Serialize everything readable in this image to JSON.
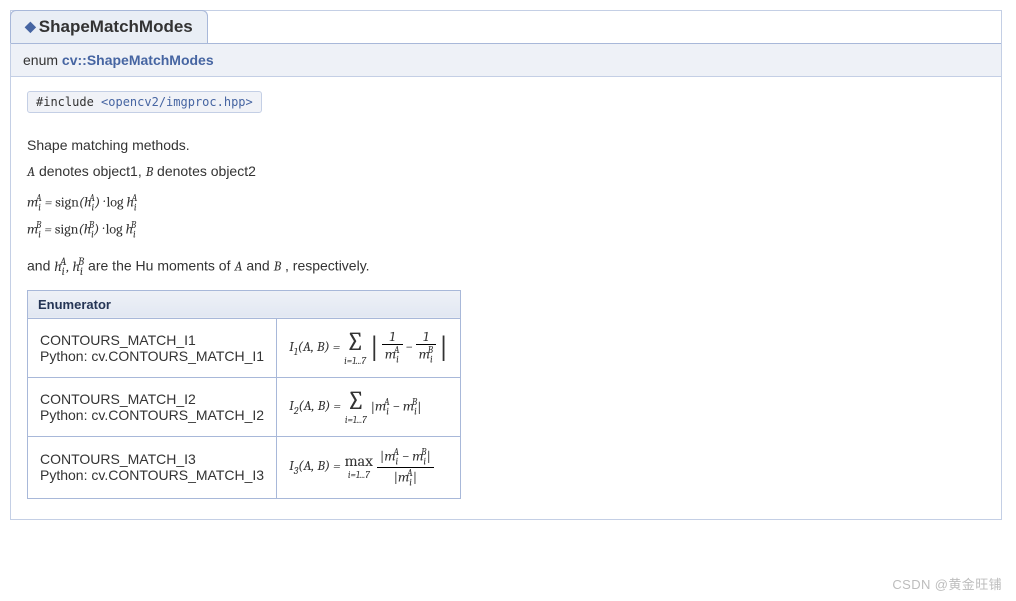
{
  "tab": {
    "title": "ShapeMatchModes"
  },
  "signature": {
    "keyword": "enum",
    "namespace": "cv::ShapeMatchModes"
  },
  "include": {
    "prefix": "#include ",
    "header": "<opencv2/imgproc.hpp>"
  },
  "description": {
    "p1": "Shape matching methods.",
    "p2_prefix": "",
    "p2_a": "A",
    "p2_mid1": " denotes object1, ",
    "p2_b": "B",
    "p2_mid2": " denotes object2",
    "formula_line1_html": "m<sub>i</sub><sup style='margin-left:-5px'>A</sup> = <span class='rm'>sign</span>(h<sub>i</sub><sup style='margin-left:-5px'>A</sup>) · <span class='rm'>log</span> h<sub>i</sub><sup style='margin-left:-5px'>A</sup>",
    "formula_line2_html": "m<sub>i</sub><sup style='margin-left:-5px'>B</sup> = <span class='rm'>sign</span>(h<sub>i</sub><sup style='margin-left:-5px'>B</sup>) · <span class='rm'>log</span> h<sub>i</sub><sup style='margin-left:-5px'>B</sup>",
    "p3_prefix": "and ",
    "p3_symbols_html": "h<sub>i</sub><sup style='margin-left:-5px'>A</sup>, h<sub>i</sub><sup style='margin-left:-5px'>B</sup>",
    "p3_mid": " are the Hu moments of ",
    "p3_a": "A",
    "p3_and": " and ",
    "p3_b": "B",
    "p3_suffix": " , respectively."
  },
  "table": {
    "header": "Enumerator",
    "rows": [
      {
        "name": "CONTOURS_MATCH_I1",
        "python": "Python: cv.CONTOURS_MATCH_I1",
        "formula": {
          "lhs": "I<sub>1</sub>(A, B) = ",
          "op": "sum",
          "op_symbol": "∑",
          "op_limit": "i=1...7",
          "body_html": "<span class='absbar' style='font-size:28px'>|</span> <span class='frac'><span class='num'>1</span><span class='bar'></span><span class='den'>m<sub>i</sub><sup style='margin-left:-5px'>A</sup></span></span> − <span class='frac'><span class='num'>1</span><span class='bar'></span><span class='den'>m<sub>i</sub><sup style='margin-left:-5px'>B</sup></span></span> <span class='absbar' style='font-size:28px'>|</span>"
        }
      },
      {
        "name": "CONTOURS_MATCH_I2",
        "python": "Python: cv.CONTOURS_MATCH_I2",
        "formula": {
          "lhs": "I<sub>2</sub>(A, B) = ",
          "op": "sum",
          "op_symbol": "∑",
          "op_limit": "i=1...7",
          "body_html": "<span class='absbar'>|</span>m<sub>i</sub><sup style='margin-left:-5px'>A</sup> − m<sub>i</sub><sup style='margin-left:-5px'>B</sup><span class='absbar'>|</span>"
        }
      },
      {
        "name": "CONTOURS_MATCH_I3",
        "python": "Python: cv.CONTOURS_MATCH_I3",
        "formula": {
          "lhs": "I<sub>3</sub>(A, B) = ",
          "op": "max",
          "op_symbol": "max",
          "op_limit": "i=1...7",
          "body_html": "<span class='frac'><span class='num'><span class='absbar'>|</span>m<sub>i</sub><sup style='margin-left:-5px'>A</sup> − m<sub>i</sub><sup style='margin-left:-5px'>B</sup><span class='absbar'>|</span></span><span class='bar'></span><span class='den'><span class='absbar'>|</span>m<sub>i</sub><sup style='margin-left:-5px'>A</sup><span class='absbar'>|</span></span></span>"
        }
      }
    ]
  },
  "watermark": "CSDN @黄金旺铺"
}
